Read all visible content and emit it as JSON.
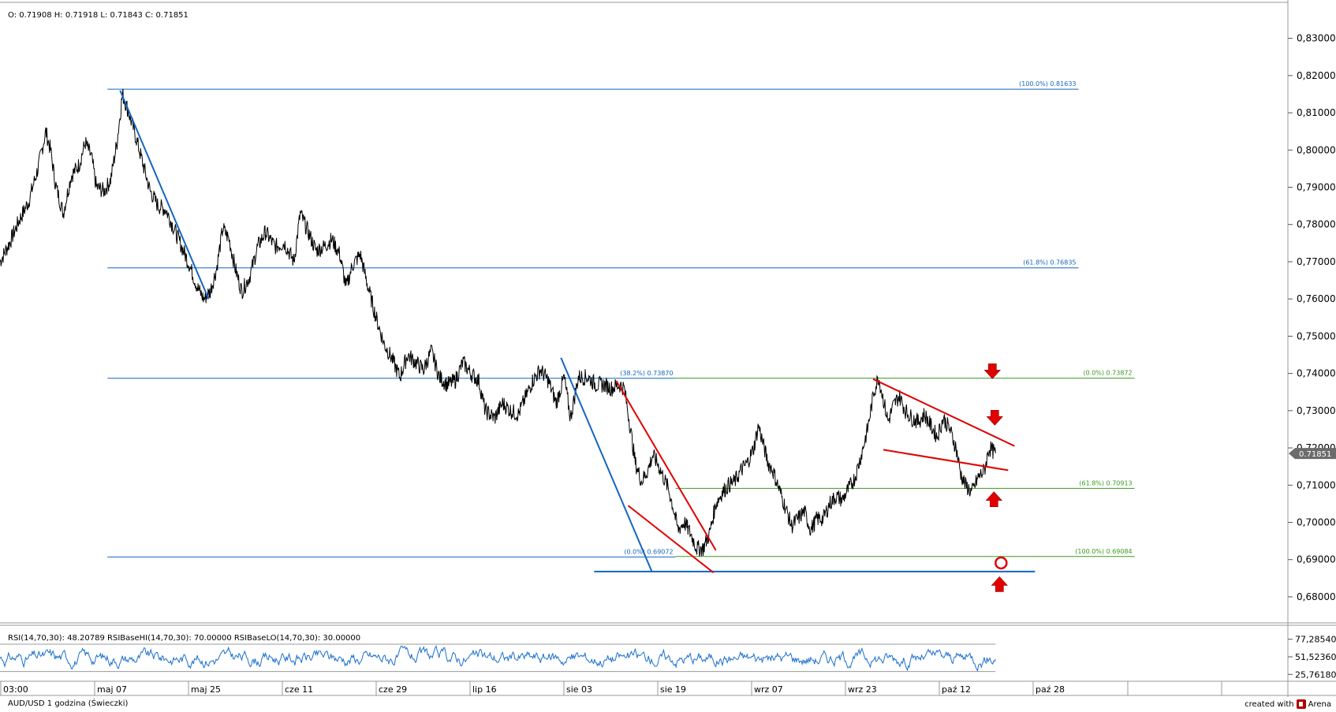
{
  "header": {
    "ohlc": "O: 0.71908  H: 0.71918  L: 0.71843  C: 0.71851"
  },
  "footer": {
    "title": "AUD/USD 1 godzina (Świeczki)",
    "brand": "created with",
    "brand_name": "Arena"
  },
  "colors": {
    "price": "#000000",
    "fib_blue": "#1565c0",
    "fib_green": "#3a9a22",
    "trend_red": "#e00000",
    "rsi": "#1b6fcf",
    "arrow": "#e00000"
  },
  "chart_data": [
    {
      "type": "line",
      "name": "price",
      "title": "",
      "ylim": [
        0.673,
        0.835
      ],
      "y_ticks": [
        "0,83000",
        "0,82000",
        "0,81000",
        "0,80000",
        "0,79000",
        "0,78000",
        "0,77000",
        "0,76000",
        "0,75000",
        "0,74000",
        "0,73000",
        "0,72000",
        "0,71000",
        "0,70000",
        "0,69000",
        "0,68000"
      ],
      "y_tick_values": [
        0.83,
        0.82,
        0.81,
        0.8,
        0.79,
        0.78,
        0.77,
        0.76,
        0.75,
        0.74,
        0.73,
        0.72,
        0.71,
        0.7,
        0.69,
        0.68
      ],
      "current_price": 0.71851,
      "current_price_label": "0.71851",
      "x_labels": [
        "03:00",
        "maj 07",
        "maj 25",
        "cze 11",
        "cze 29",
        "lip 16",
        "sie 03",
        "sie 19",
        "wrz 07",
        "wrz 23",
        "paź 12",
        "paź 28"
      ],
      "xlim": [
        0,
        1630
      ],
      "series_anchor_points": [
        [
          0,
          0.77
        ],
        [
          12,
          0.775
        ],
        [
          24,
          0.781
        ],
        [
          36,
          0.786
        ],
        [
          48,
          0.795
        ],
        [
          58,
          0.805
        ],
        [
          64,
          0.8
        ],
        [
          70,
          0.791
        ],
        [
          80,
          0.783
        ],
        [
          90,
          0.793
        ],
        [
          100,
          0.796
        ],
        [
          108,
          0.802
        ],
        [
          116,
          0.798
        ],
        [
          122,
          0.79
        ],
        [
          132,
          0.789
        ],
        [
          140,
          0.792
        ],
        [
          148,
          0.802
        ],
        [
          155,
          0.815
        ],
        [
          160,
          0.812
        ],
        [
          170,
          0.805
        ],
        [
          180,
          0.797
        ],
        [
          190,
          0.789
        ],
        [
          200,
          0.785
        ],
        [
          210,
          0.784
        ],
        [
          220,
          0.779
        ],
        [
          232,
          0.773
        ],
        [
          240,
          0.769
        ],
        [
          250,
          0.763
        ],
        [
          258,
          0.76
        ],
        [
          266,
          0.762
        ],
        [
          274,
          0.768
        ],
        [
          282,
          0.779
        ],
        [
          290,
          0.776
        ],
        [
          298,
          0.768
        ],
        [
          306,
          0.762
        ],
        [
          316,
          0.766
        ],
        [
          326,
          0.774
        ],
        [
          336,
          0.778
        ],
        [
          348,
          0.774
        ],
        [
          360,
          0.775
        ],
        [
          372,
          0.77
        ],
        [
          380,
          0.783
        ],
        [
          390,
          0.778
        ],
        [
          400,
          0.773
        ],
        [
          410,
          0.774
        ],
        [
          420,
          0.776
        ],
        [
          430,
          0.772
        ],
        [
          438,
          0.763
        ],
        [
          446,
          0.769
        ],
        [
          456,
          0.772
        ],
        [
          466,
          0.763
        ],
        [
          476,
          0.755
        ],
        [
          486,
          0.748
        ],
        [
          496,
          0.744
        ],
        [
          506,
          0.739
        ],
        [
          516,
          0.745
        ],
        [
          526,
          0.743
        ],
        [
          536,
          0.741
        ],
        [
          546,
          0.746
        ],
        [
          556,
          0.739
        ],
        [
          566,
          0.737
        ],
        [
          576,
          0.738
        ],
        [
          586,
          0.743
        ],
        [
          596,
          0.74
        ],
        [
          606,
          0.738
        ],
        [
          614,
          0.73
        ],
        [
          626,
          0.728
        ],
        [
          636,
          0.732
        ],
        [
          646,
          0.73
        ],
        [
          656,
          0.729
        ],
        [
          664,
          0.733
        ],
        [
          674,
          0.738
        ],
        [
          684,
          0.741
        ],
        [
          694,
          0.738
        ],
        [
          704,
          0.732
        ],
        [
          714,
          0.739
        ],
        [
          722,
          0.728
        ],
        [
          732,
          0.739
        ],
        [
          744,
          0.739
        ],
        [
          754,
          0.737
        ],
        [
          764,
          0.737
        ],
        [
          774,
          0.736
        ],
        [
          784,
          0.737
        ],
        [
          790,
          0.736
        ],
        [
          796,
          0.728
        ],
        [
          804,
          0.716
        ],
        [
          812,
          0.711
        ],
        [
          820,
          0.714
        ],
        [
          826,
          0.718
        ],
        [
          832,
          0.716
        ],
        [
          840,
          0.712
        ],
        [
          846,
          0.709
        ],
        [
          852,
          0.704
        ],
        [
          858,
          0.698
        ],
        [
          866,
          0.7
        ],
        [
          874,
          0.697
        ],
        [
          882,
          0.693
        ],
        [
          890,
          0.693
        ],
        [
          898,
          0.697
        ],
        [
          906,
          0.705
        ],
        [
          914,
          0.708
        ],
        [
          922,
          0.71
        ],
        [
          930,
          0.711
        ],
        [
          938,
          0.714
        ],
        [
          946,
          0.716
        ],
        [
          954,
          0.72
        ],
        [
          960,
          0.726
        ],
        [
          966,
          0.721
        ],
        [
          972,
          0.716
        ],
        [
          978,
          0.714
        ],
        [
          986,
          0.709
        ],
        [
          994,
          0.704
        ],
        [
          1002,
          0.699
        ],
        [
          1010,
          0.701
        ],
        [
          1018,
          0.703
        ],
        [
          1026,
          0.698
        ],
        [
          1034,
          0.701
        ],
        [
          1042,
          0.701
        ],
        [
          1050,
          0.705
        ],
        [
          1058,
          0.707
        ],
        [
          1066,
          0.706
        ],
        [
          1074,
          0.709
        ],
        [
          1082,
          0.712
        ],
        [
          1090,
          0.718
        ],
        [
          1098,
          0.725
        ],
        [
          1106,
          0.735
        ],
        [
          1112,
          0.739
        ],
        [
          1118,
          0.733
        ],
        [
          1124,
          0.727
        ],
        [
          1130,
          0.731
        ],
        [
          1138,
          0.734
        ],
        [
          1146,
          0.73
        ],
        [
          1154,
          0.728
        ],
        [
          1162,
          0.727
        ],
        [
          1170,
          0.729
        ],
        [
          1178,
          0.726
        ],
        [
          1186,
          0.723
        ],
        [
          1194,
          0.728
        ],
        [
          1202,
          0.725
        ],
        [
          1210,
          0.72
        ],
        [
          1216,
          0.713
        ],
        [
          1222,
          0.71
        ],
        [
          1230,
          0.708
        ],
        [
          1238,
          0.712
        ],
        [
          1246,
          0.714
        ],
        [
          1252,
          0.72
        ],
        [
          1260,
          0.7185
        ]
      ]
    },
    {
      "type": "line",
      "name": "rsi",
      "title": "",
      "header": "RSI(14,70,30): 48.20789   RSIBaseHI(14,70,30): 70.00000   RSIBaseLO(14,70,30): 30.00000",
      "ylim": [
        18,
        92
      ],
      "y_ticks": [
        "77,28540",
        "51,52360",
        "25,76180"
      ],
      "y_tick_values": [
        77.2854,
        51.5236,
        25.7618
      ],
      "base_hi": 70,
      "base_lo": 30,
      "current": 48.20789
    }
  ],
  "fib_levels": [
    {
      "price": 0.81633,
      "label": "(100.0%) 0.81633",
      "color": "#1565c0",
      "x1": 136,
      "x2": 1365
    },
    {
      "price": 0.76835,
      "label": "(61.8%) 0.76835",
      "color": "#1565c0",
      "x1": 136,
      "x2": 1365
    },
    {
      "price": 0.7387,
      "label": "(38.2%) 0.73870",
      "color": "#1565c0",
      "x1": 136,
      "x2": 855
    },
    {
      "price": 0.73872,
      "label": "(0.0%) 0.73872",
      "color": "#3a9a22",
      "x1": 855,
      "x2": 1436
    },
    {
      "price": 0.70913,
      "label": "(61.8%) 0.70913",
      "color": "#3a9a22",
      "x1": 855,
      "x2": 1436
    },
    {
      "price": 0.69072,
      "label": "(0.0%) 0.69072",
      "color": "#1565c0",
      "x1": 136,
      "x2": 855
    },
    {
      "price": 0.69084,
      "label": "(100.0%) 0.69084",
      "color": "#3a9a22",
      "x1": 855,
      "x2": 1436
    }
  ],
  "support_line": {
    "price": 0.6868,
    "x1": 752,
    "x2": 1310
  },
  "trend_lines": [
    {
      "color": "#1565c0",
      "x1": 152,
      "y1": 0.816,
      "x2": 264,
      "y2": 0.76
    },
    {
      "color": "#1565c0",
      "x1": 710,
      "y1": 0.7442,
      "x2": 825,
      "y2": 0.6868
    },
    {
      "color": "#e00000",
      "x1": 780,
      "y1": 0.738,
      "x2": 906,
      "y2": 0.6925
    },
    {
      "color": "#e00000",
      "x1": 795,
      "y1": 0.7045,
      "x2": 903,
      "y2": 0.6865
    },
    {
      "color": "#e00000",
      "x1": 1105,
      "y1": 0.7385,
      "x2": 1284,
      "y2": 0.7205
    },
    {
      "color": "#e00000",
      "x1": 1118,
      "y1": 0.7195,
      "x2": 1276,
      "y2": 0.714
    }
  ],
  "arrows": [
    {
      "dir": "down",
      "x": 1256,
      "price": 0.7405
    },
    {
      "dir": "down",
      "x": 1259,
      "price": 0.728
    },
    {
      "dir": "up",
      "x": 1258,
      "price": 0.7063
    },
    {
      "dir": "up",
      "x": 1265,
      "price": 0.6835
    }
  ],
  "circle_marker": {
    "x": 1267,
    "price": 0.6891
  }
}
